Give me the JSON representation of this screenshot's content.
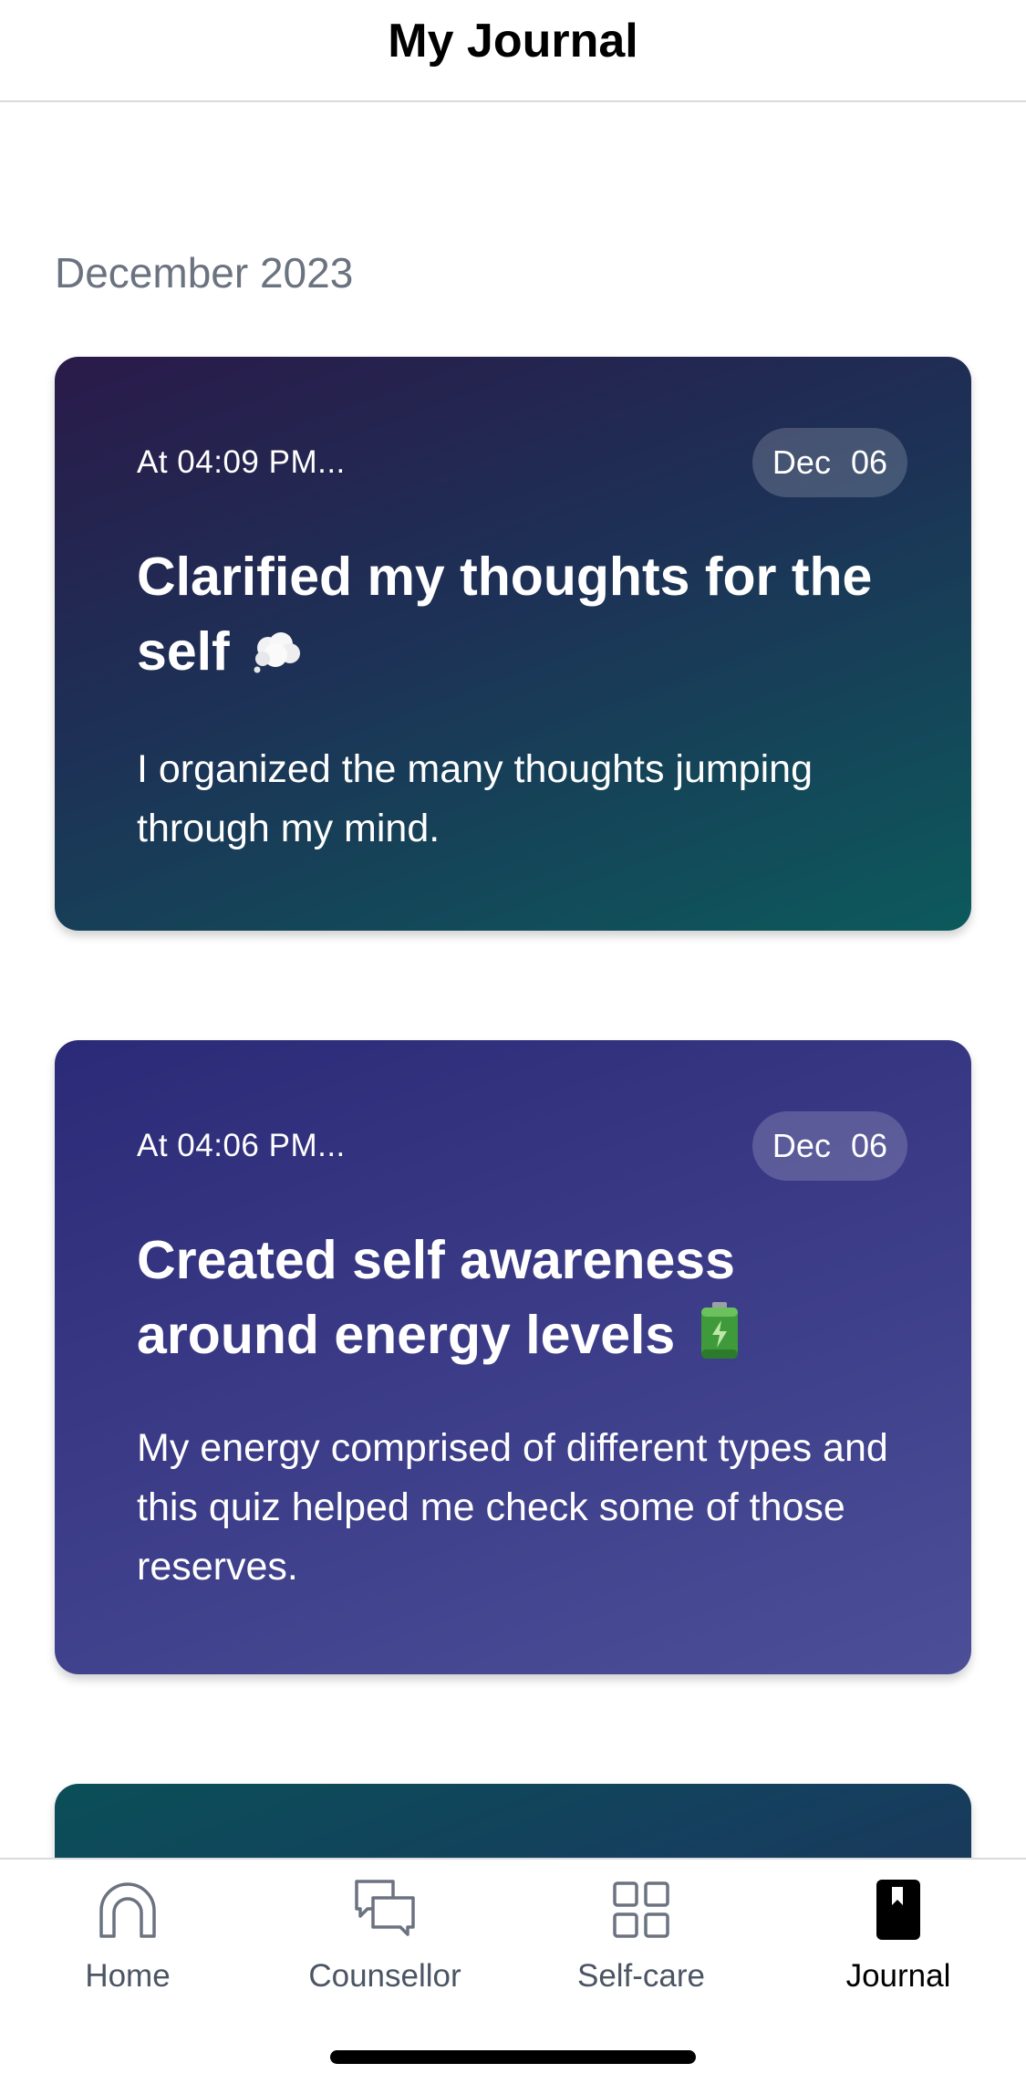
{
  "header": {
    "title": "My Journal"
  },
  "month": "December 2023",
  "entries": [
    {
      "time": "At 04:09 PM...",
      "month_short": "Dec",
      "day": "06",
      "title": "Clarified my thoughts for the self",
      "emoji_icon": "thought-balloon-icon",
      "description": "I organized the many thoughts jumping through my mind."
    },
    {
      "time": "At 04:06 PM...",
      "month_short": "Dec",
      "day": "06",
      "title": "Created self awareness around energy levels",
      "emoji_icon": "battery-icon",
      "description": "My energy comprised of different types and this quiz helped me check some of those reserves."
    }
  ],
  "tabs": [
    {
      "label": "Home",
      "icon": "home-icon"
    },
    {
      "label": "Counsellor",
      "icon": "chat-bubbles-icon"
    },
    {
      "label": "Self-care",
      "icon": "grid-icon"
    },
    {
      "label": "Journal",
      "icon": "journal-book-icon",
      "active": true
    }
  ]
}
